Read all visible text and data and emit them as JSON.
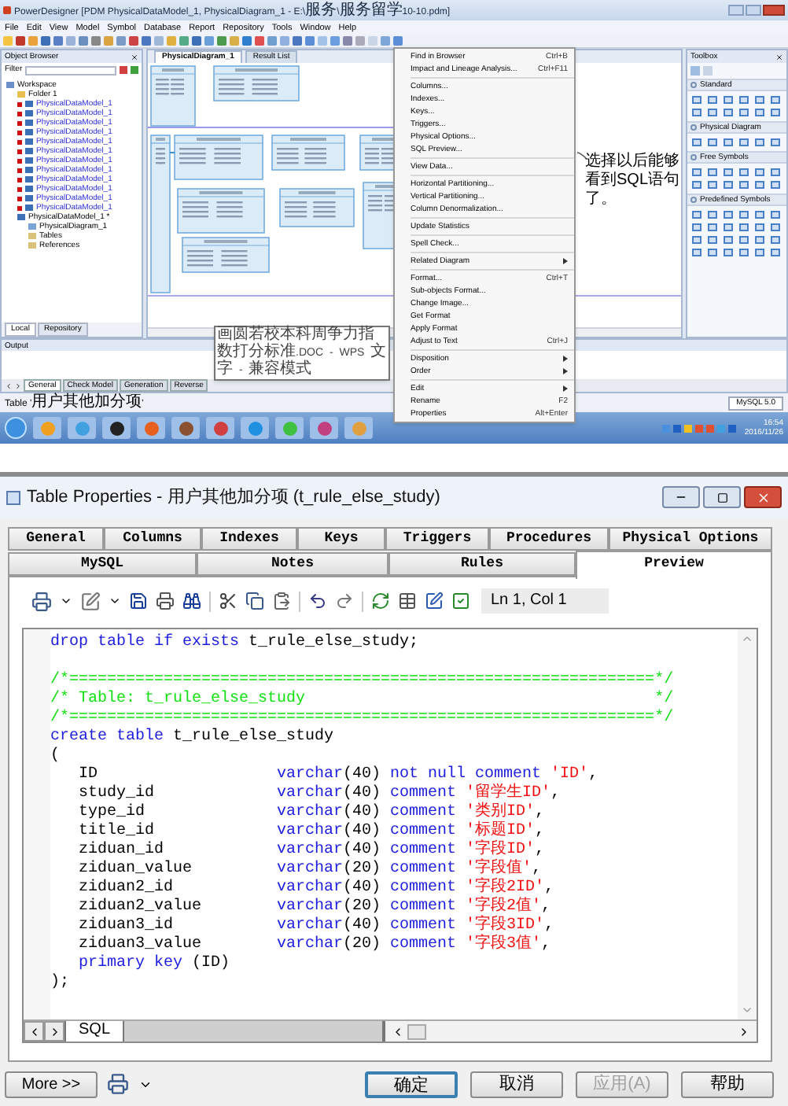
{
  "designer": {
    "title": "PowerDesigner [PDM PhysicalDataModel_1, PhysicalDiagram_1 - E:\\服务\\服务留学10-10.pdm]",
    "menu": [
      "File",
      "Edit",
      "View",
      "Model",
      "Symbol",
      "Database",
      "Report",
      "Repository",
      "Tools",
      "Window",
      "Help"
    ],
    "object_browser": {
      "title": "Object Browser",
      "filter_label": "Filter",
      "tree": [
        {
          "label": "Workspace",
          "kind": "workspace",
          "children": [
            {
              "label": "Folder 1",
              "kind": "folder"
            },
            {
              "label": "PhysicalDataModel_1",
              "kind": "shortcut"
            },
            {
              "label": "PhysicalDataModel_1",
              "kind": "shortcut"
            },
            {
              "label": "PhysicalDataModel_1",
              "kind": "shortcut"
            },
            {
              "label": "PhysicalDataModel_1",
              "kind": "shortcut"
            },
            {
              "label": "PhysicalDataModel_1",
              "kind": "shortcut"
            },
            {
              "label": "PhysicalDataModel_1",
              "kind": "shortcut"
            },
            {
              "label": "PhysicalDataModel_1",
              "kind": "shortcut"
            },
            {
              "label": "PhysicalDataModel_1",
              "kind": "shortcut"
            },
            {
              "label": "PhysicalDataModel_1",
              "kind": "shortcut"
            },
            {
              "label": "PhysicalDataModel_1",
              "kind": "shortcut"
            },
            {
              "label": "PhysicalDataModel_1",
              "kind": "shortcut"
            },
            {
              "label": "PhysicalDataModel_1",
              "kind": "shortcut"
            },
            {
              "label": "PhysicalDataModel_1 *",
              "kind": "model",
              "children": [
                {
                  "label": "PhysicalDiagram_1",
                  "kind": "diagram"
                },
                {
                  "label": "Tables",
                  "kind": "category"
                },
                {
                  "label": "References",
                  "kind": "category"
                }
              ]
            }
          ]
        }
      ],
      "tabs": [
        {
          "label": "Local",
          "selected": true
        },
        {
          "label": "Repository",
          "selected": false
        }
      ]
    },
    "diagram_tabs": [
      {
        "label": "PhysicalDiagram_1",
        "selected": true
      },
      {
        "label": "Result List",
        "selected": false
      }
    ],
    "context_menu": [
      {
        "kind": "item",
        "label": "Find in Browser",
        "shortcut": "Ctrl+B"
      },
      {
        "kind": "item",
        "label": "Impact and Lineage Analysis...",
        "shortcut": "Ctrl+F11"
      },
      {
        "kind": "separator"
      },
      {
        "kind": "item",
        "label": "Columns..."
      },
      {
        "kind": "item",
        "label": "Indexes..."
      },
      {
        "kind": "item",
        "label": "Keys..."
      },
      {
        "kind": "item",
        "label": "Triggers..."
      },
      {
        "kind": "item",
        "label": "Physical Options..."
      },
      {
        "kind": "item",
        "label": "SQL Preview..."
      },
      {
        "kind": "separator"
      },
      {
        "kind": "item",
        "label": "View Data..."
      },
      {
        "kind": "separator"
      },
      {
        "kind": "item",
        "label": "Horizontal Partitioning..."
      },
      {
        "kind": "item",
        "label": "Vertical Partitioning..."
      },
      {
        "kind": "item",
        "label": "Column Denormalization..."
      },
      {
        "kind": "separator"
      },
      {
        "kind": "item",
        "label": "Update Statistics"
      },
      {
        "kind": "separator"
      },
      {
        "kind": "item",
        "label": "Spell Check..."
      },
      {
        "kind": "separator"
      },
      {
        "kind": "submenu",
        "label": "Related Diagram"
      },
      {
        "kind": "separator"
      },
      {
        "kind": "item",
        "label": "Format...",
        "shortcut": "Ctrl+T"
      },
      {
        "kind": "item",
        "label": "Sub-objects Format..."
      },
      {
        "kind": "item",
        "label": "Change Image..."
      },
      {
        "kind": "item",
        "label": "Get Format"
      },
      {
        "kind": "item",
        "label": "Apply Format"
      },
      {
        "kind": "item",
        "label": "Adjust to Text",
        "shortcut": "Ctrl+J"
      },
      {
        "kind": "separator"
      },
      {
        "kind": "submenu",
        "label": "Disposition"
      },
      {
        "kind": "submenu",
        "label": "Order"
      },
      {
        "kind": "separator"
      },
      {
        "kind": "submenu",
        "label": "Edit"
      },
      {
        "kind": "item",
        "label": "Rename",
        "shortcut": "F2"
      },
      {
        "kind": "item",
        "label": "Properties",
        "shortcut": "Alt+Enter"
      }
    ],
    "annotation": "选择以后能够看到SQL语句了。",
    "toolbox": {
      "title": "Toolbox",
      "sections": [
        {
          "label": "Standard"
        },
        {
          "label": "Physical Diagram"
        },
        {
          "label": "Free Symbols"
        },
        {
          "label": "Predefined Symbols"
        }
      ]
    },
    "output": {
      "title": "Output",
      "tabs": [
        {
          "label": "General",
          "selected": true
        },
        {
          "label": "Check Model",
          "selected": false
        },
        {
          "label": "Generation",
          "selected": false
        },
        {
          "label": "Reverse",
          "selected": false
        }
      ]
    },
    "status": "Table '用户其他加分项'",
    "tooltip": "画圆若校本科周争力指数打分标准.DOC - WPS 文字 - 兼容模式",
    "dbms": "MySQL 5.0",
    "clock": {
      "time": "16:54",
      "date": "2016/11/26"
    }
  },
  "dialog": {
    "title": "Table Properties - 用户其他加分项 (t_rule_else_study)",
    "tab_rows": [
      {
        "tabs": [
          {
            "label": "General",
            "selected": false
          },
          {
            "label": "Columns",
            "selected": false
          },
          {
            "label": "Indexes",
            "selected": false
          },
          {
            "label": "Keys",
            "selected": false
          },
          {
            "label": "Triggers",
            "selected": false
          },
          {
            "label": "Procedures",
            "selected": false
          },
          {
            "label": "Physical Options",
            "selected": false
          }
        ]
      },
      {
        "tabs": [
          {
            "label": "MySQL",
            "selected": false
          },
          {
            "label": "Notes",
            "selected": false
          },
          {
            "label": "Rules",
            "selected": false
          },
          {
            "label": "Preview",
            "selected": true
          }
        ]
      }
    ],
    "position": "Ln 1, Col 1",
    "code_lines": [
      {
        "kind": "code",
        "tokens": [
          {
            "kind": "keyword",
            "text": "drop table if exists"
          },
          {
            "kind": "plain",
            "text": " t_rule_else_study;"
          }
        ]
      },
      {
        "kind": "blank"
      },
      {
        "kind": "code",
        "tokens": [
          {
            "kind": "comment",
            "text": "/*==============================================================*/"
          }
        ]
      },
      {
        "kind": "code",
        "tokens": [
          {
            "kind": "comment",
            "text": "/* Table: t_rule_else_study                                     */"
          }
        ]
      },
      {
        "kind": "code",
        "tokens": [
          {
            "kind": "comment",
            "text": "/*==============================================================*/"
          }
        ]
      },
      {
        "kind": "code",
        "tokens": [
          {
            "kind": "keyword",
            "text": "create table"
          },
          {
            "kind": "plain",
            "text": " t_rule_else_study"
          }
        ]
      },
      {
        "kind": "code",
        "tokens": [
          {
            "kind": "plain",
            "text": "("
          }
        ]
      },
      {
        "kind": "column",
        "name": "ID",
        "tokens": [
          {
            "kind": "keyword",
            "text": "varchar"
          },
          {
            "kind": "plain",
            "text": "(40) "
          },
          {
            "kind": "keyword",
            "text": "not null comment"
          },
          {
            "kind": "string",
            "text": "'ID'"
          },
          {
            "kind": "plain",
            "text": ","
          }
        ]
      },
      {
        "kind": "column",
        "name": "study_id",
        "tokens": [
          {
            "kind": "keyword",
            "text": "varchar"
          },
          {
            "kind": "plain",
            "text": "(40) "
          },
          {
            "kind": "keyword",
            "text": "comment"
          },
          {
            "kind": "string",
            "text": "'留学生ID'"
          },
          {
            "kind": "plain",
            "text": ","
          }
        ]
      },
      {
        "kind": "column",
        "name": "type_id",
        "tokens": [
          {
            "kind": "keyword",
            "text": "varchar"
          },
          {
            "kind": "plain",
            "text": "(40) "
          },
          {
            "kind": "keyword",
            "text": "comment"
          },
          {
            "kind": "string",
            "text": "'类别ID'"
          },
          {
            "kind": "plain",
            "text": ","
          }
        ]
      },
      {
        "kind": "column",
        "name": "title_id",
        "tokens": [
          {
            "kind": "keyword",
            "text": "varchar"
          },
          {
            "kind": "plain",
            "text": "(40) "
          },
          {
            "kind": "keyword",
            "text": "comment"
          },
          {
            "kind": "string",
            "text": "'标题ID'"
          },
          {
            "kind": "plain",
            "text": ","
          }
        ]
      },
      {
        "kind": "column",
        "name": "ziduan_id",
        "tokens": [
          {
            "kind": "keyword",
            "text": "varchar"
          },
          {
            "kind": "plain",
            "text": "(40) "
          },
          {
            "kind": "keyword",
            "text": "comment"
          },
          {
            "kind": "string",
            "text": "'字段ID'"
          },
          {
            "kind": "plain",
            "text": ","
          }
        ]
      },
      {
        "kind": "column",
        "name": "ziduan_value",
        "tokens": [
          {
            "kind": "keyword",
            "text": "varchar"
          },
          {
            "kind": "plain",
            "text": "(20) "
          },
          {
            "kind": "keyword",
            "text": "comment"
          },
          {
            "kind": "string",
            "text": "'字段值'"
          },
          {
            "kind": "plain",
            "text": ","
          }
        ]
      },
      {
        "kind": "column",
        "name": "ziduan2_id",
        "tokens": [
          {
            "kind": "keyword",
            "text": "varchar"
          },
          {
            "kind": "plain",
            "text": "(40) "
          },
          {
            "kind": "keyword",
            "text": "comment"
          },
          {
            "kind": "string",
            "text": "'字段2ID'"
          },
          {
            "kind": "plain",
            "text": ","
          }
        ]
      },
      {
        "kind": "column",
        "name": "ziduan2_value",
        "tokens": [
          {
            "kind": "keyword",
            "text": "varchar"
          },
          {
            "kind": "plain",
            "text": "(20) "
          },
          {
            "kind": "keyword",
            "text": "comment"
          },
          {
            "kind": "string",
            "text": "'字段2值'"
          },
          {
            "kind": "plain",
            "text": ","
          }
        ]
      },
      {
        "kind": "column",
        "name": "ziduan3_id",
        "tokens": [
          {
            "kind": "keyword",
            "text": "varchar"
          },
          {
            "kind": "plain",
            "text": "(40) "
          },
          {
            "kind": "keyword",
            "text": "comment"
          },
          {
            "kind": "string",
            "text": "'字段3ID'"
          },
          {
            "kind": "plain",
            "text": ","
          }
        ]
      },
      {
        "kind": "column",
        "name": "ziduan3_value",
        "tokens": [
          {
            "kind": "keyword",
            "text": "varchar"
          },
          {
            "kind": "plain",
            "text": "(20) "
          },
          {
            "kind": "keyword",
            "text": "comment"
          },
          {
            "kind": "string",
            "text": "'字段3值'"
          },
          {
            "kind": "plain",
            "text": ","
          }
        ]
      },
      {
        "kind": "indented",
        "tokens": [
          {
            "kind": "keyword",
            "text": "primary key"
          },
          {
            "kind": "plain",
            "text": " (ID)"
          }
        ]
      },
      {
        "kind": "code",
        "tokens": [
          {
            "kind": "plain",
            "text": ");"
          }
        ]
      }
    ],
    "editor_tabs": [
      {
        "label": "SQL",
        "selected": true
      }
    ],
    "more_button": "More >>",
    "buttons": [
      {
        "label": "确定",
        "default": true,
        "disabled": false
      },
      {
        "label": "取消",
        "default": false,
        "disabled": false
      },
      {
        "label": "应用(A)",
        "default": false,
        "disabled": true
      },
      {
        "label": "帮助",
        "default": false,
        "disabled": false
      }
    ]
  }
}
